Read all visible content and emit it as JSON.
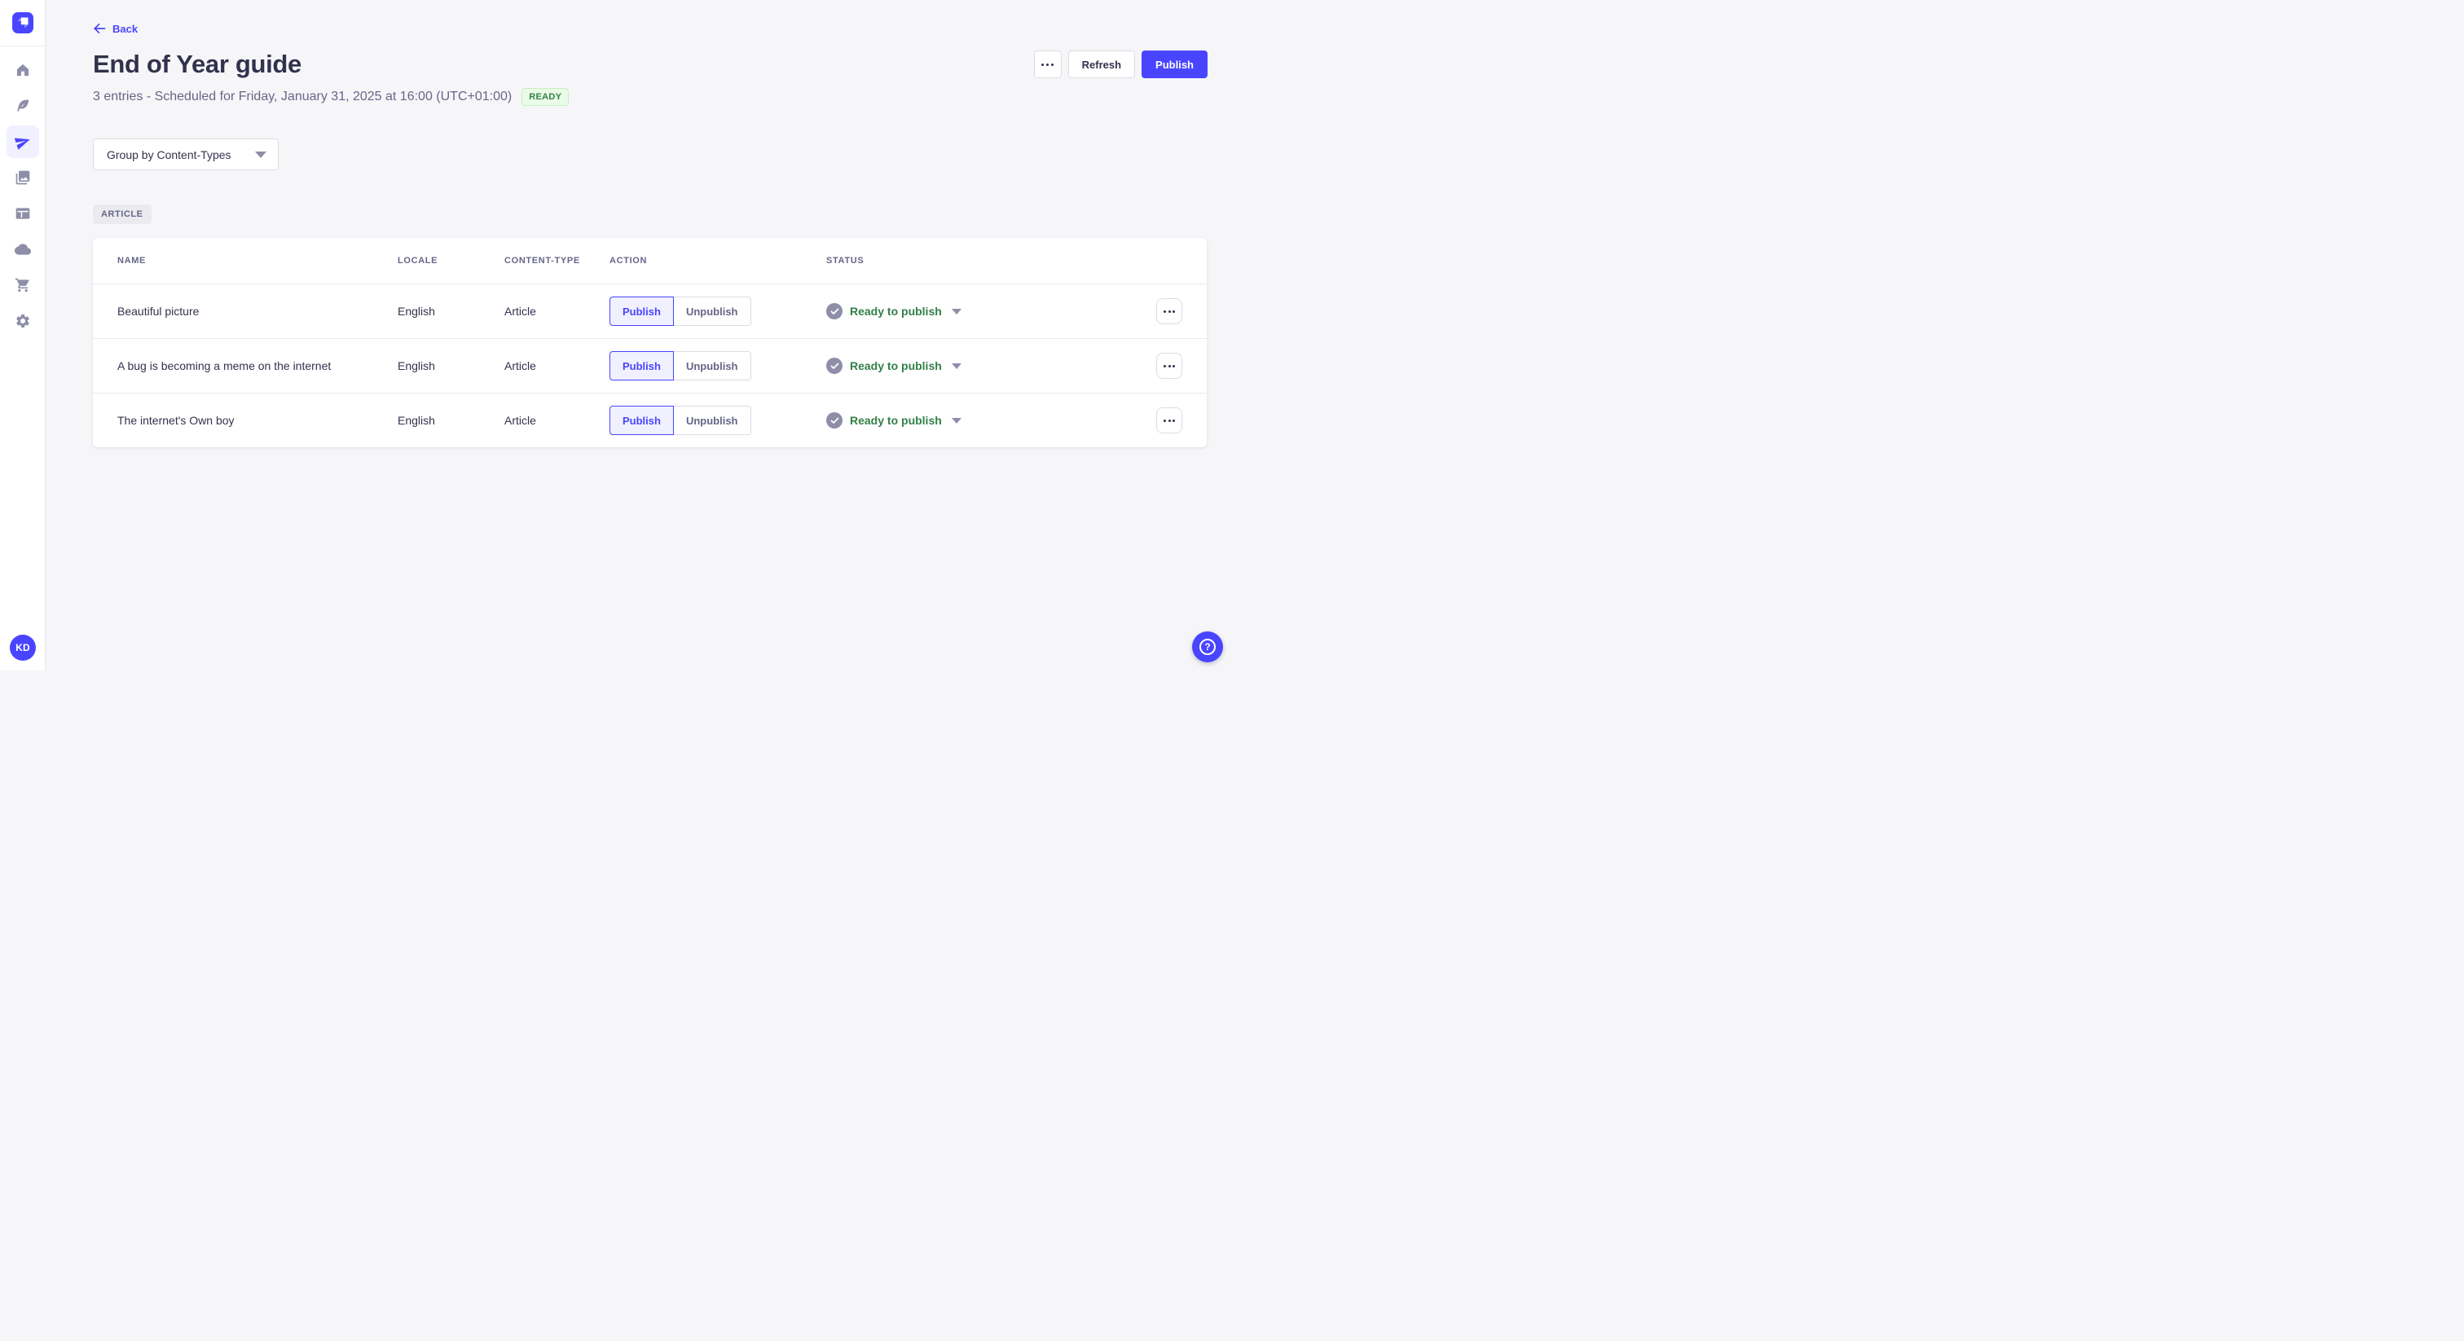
{
  "app": {
    "name": "Strapi admin"
  },
  "colors": {
    "accent": "#4945FF",
    "accent_light": "#F0F0FF",
    "success_text": "#328048",
    "success_bg": "#EAFBE7",
    "success_border": "#C6F0C2",
    "neutral_text": "#32324D",
    "muted_text": "#666687",
    "icon_gray": "#8E8EA9",
    "border": "#DCDCE4",
    "divider": "#EAEAEF",
    "page_bg": "#F6F6F9"
  },
  "sidebar": {
    "items": [
      {
        "id": "home",
        "icon": "home-icon",
        "active": false
      },
      {
        "id": "content-manager",
        "icon": "feather-icon",
        "active": false
      },
      {
        "id": "releases",
        "icon": "paper-plane-icon",
        "active": true
      },
      {
        "id": "media-library",
        "icon": "images-icon",
        "active": false
      },
      {
        "id": "content-type-builder",
        "icon": "layout-icon",
        "active": false
      },
      {
        "id": "deploy",
        "icon": "cloud-icon",
        "active": false
      },
      {
        "id": "marketplace",
        "icon": "cart-icon",
        "active": false
      },
      {
        "id": "settings",
        "icon": "gear-icon",
        "active": false
      }
    ],
    "avatar_initials": "KD"
  },
  "header": {
    "back_label": "Back",
    "title": "End of Year guide",
    "subtitle": "3 entries - Scheduled for Friday, January 31, 2025 at 16:00 (UTC+01:00)",
    "status_badge": "READY",
    "refresh_label": "Refresh",
    "publish_label": "Publish"
  },
  "toolbar": {
    "group_by_label": "Group by Content-Types"
  },
  "group": {
    "badge": "ARTICLE"
  },
  "table": {
    "columns": [
      "NAME",
      "LOCALE",
      "CONTENT-TYPE",
      "ACTION",
      "STATUS"
    ],
    "rows": [
      {
        "name": "Beautiful picture",
        "locale": "English",
        "content_type": "Article",
        "action_publish": "Publish",
        "action_unpublish": "Unpublish",
        "status": "Ready to publish"
      },
      {
        "name": "A bug is becoming a meme on the internet",
        "locale": "English",
        "content_type": "Article",
        "action_publish": "Publish",
        "action_unpublish": "Unpublish",
        "status": "Ready to publish"
      },
      {
        "name": "The internet's Own boy",
        "locale": "English",
        "content_type": "Article",
        "action_publish": "Publish",
        "action_unpublish": "Unpublish",
        "status": "Ready to publish"
      }
    ]
  }
}
